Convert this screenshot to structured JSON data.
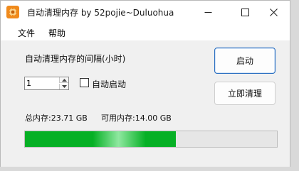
{
  "window": {
    "title": "自动清理内存 by 52pojie~Duluohua"
  },
  "menu": {
    "items": [
      {
        "label": "文件"
      },
      {
        "label": "帮助"
      }
    ]
  },
  "interval": {
    "label": "自动清理内存的间隔(小时)",
    "value": "1"
  },
  "auto_start": {
    "label": "自动启动",
    "checked": false
  },
  "buttons": {
    "start_label": "启动",
    "clean_label": "立即清理"
  },
  "memory": {
    "total_text": "总内存:23.71 GB",
    "available_text": "可用内存:14.00 GB",
    "usage_fraction": 0.6
  },
  "colors": {
    "progress_green": "#06b025",
    "accent_border": "#2a6fc1"
  }
}
